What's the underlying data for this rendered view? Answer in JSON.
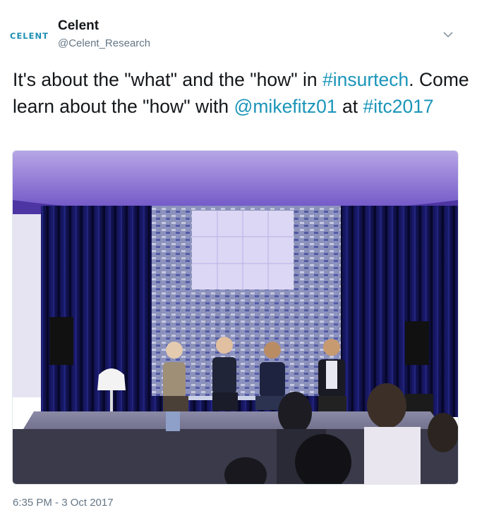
{
  "author": {
    "avatar_text": "CELENT",
    "display_name": "Celent",
    "handle": "@Celent_Research"
  },
  "tweet": {
    "text_1": "It's about the  \"what\" and the \"how\" in ",
    "hashtag_1": "#insurtech",
    "text_2": ". Come learn about the \"how\" with ",
    "mention": "@mikefitz01",
    "text_3": " at ",
    "hashtag_2": "#itc2017"
  },
  "timestamp": "6:35 PM - 3 Oct 2017",
  "colors": {
    "link": "#1b95b9",
    "brand": "#1d8fb3",
    "meta": "#657786"
  },
  "icons": {
    "menu": "chevron-down-icon"
  }
}
